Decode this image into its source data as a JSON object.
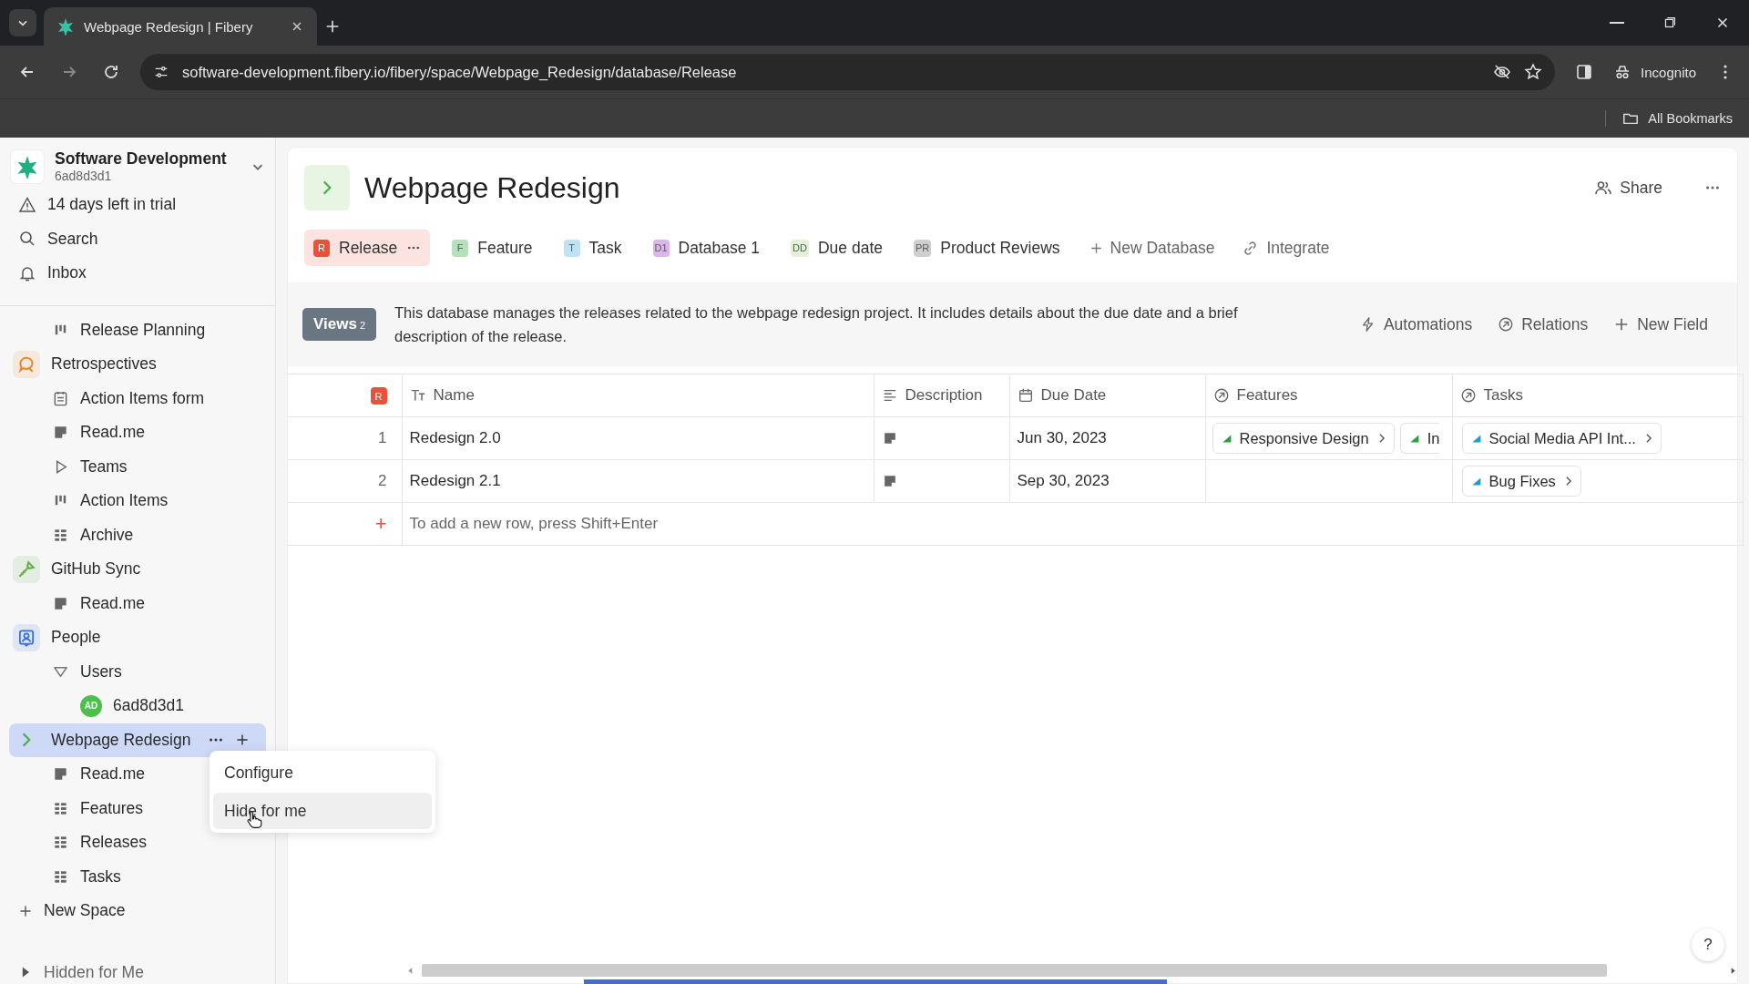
{
  "browser": {
    "tab_title": "Webpage Redesign | Fibery",
    "url": "software-development.fibery.io/fibery/space/Webpage_Redesign/database/Release",
    "profile": "Incognito",
    "bookmarks": "All Bookmarks"
  },
  "sidebar": {
    "workspace": {
      "name": "Software Development",
      "id": "6ad8d3d1"
    },
    "top_items": [
      {
        "kind": "warning",
        "label": "14 days left in trial"
      },
      {
        "kind": "search",
        "label": "Search"
      },
      {
        "kind": "bell",
        "label": "Inbox"
      }
    ],
    "orphan_items": [
      {
        "kind": "board",
        "label": "Release Planning"
      }
    ],
    "spaces": [
      {
        "kind": "retro",
        "label": "Retrospectives",
        "color": "#e8862a",
        "selected": false,
        "children": [
          {
            "kind": "form",
            "label": "Action Items form"
          },
          {
            "kind": "doc",
            "label": "Read.me"
          },
          {
            "kind": "view",
            "label": "Teams"
          },
          {
            "kind": "board",
            "label": "Action Items"
          },
          {
            "kind": "grid",
            "label": "Archive"
          }
        ]
      },
      {
        "kind": "sync",
        "label": "GitHub Sync",
        "color": "#6ab04c",
        "selected": false,
        "children": [
          {
            "kind": "doc",
            "label": "Read.me"
          }
        ]
      },
      {
        "kind": "people",
        "label": "People",
        "color": "#3b6fd8",
        "selected": false,
        "children": [
          {
            "kind": "folder",
            "label": "Users",
            "expanded": true,
            "children": [
              {
                "kind": "avatar",
                "label": "6ad8d3d1",
                "initials": "AD"
              }
            ]
          }
        ]
      },
      {
        "kind": "chevron",
        "label": "Webpage Redesign",
        "color": "#4caf50",
        "selected": true,
        "children": [
          {
            "kind": "doc",
            "label": "Read.me"
          },
          {
            "kind": "grid",
            "label": "Features"
          },
          {
            "kind": "grid",
            "label": "Releases"
          },
          {
            "kind": "grid",
            "label": "Tasks"
          }
        ]
      }
    ],
    "new_space": "New Space",
    "hidden_section": "Hidden for Me"
  },
  "context_menu": {
    "items": [
      {
        "label": "Configure",
        "selected": false
      },
      {
        "label": "Hide for me",
        "selected": true
      }
    ]
  },
  "page": {
    "title": "Webpage Redesign",
    "share": "Share",
    "tabs": [
      {
        "badge": "R",
        "label": "Release",
        "color": "#e5533d",
        "selected": true
      },
      {
        "badge": "F",
        "label": "Feature",
        "color": "#b5e0bc",
        "selected": false
      },
      {
        "badge": "T",
        "label": "Task",
        "color": "#bfe2f4",
        "selected": false
      },
      {
        "badge": "D1",
        "label": "Database 1",
        "color": "#dcb6ea",
        "selected": false
      },
      {
        "badge": "DD",
        "label": "Due date",
        "color": "#e3f1d6",
        "selected": false
      },
      {
        "badge": "PR",
        "label": "Product Reviews",
        "color": "#cfcfcf",
        "selected": false
      }
    ],
    "new_database": "New Database",
    "integrate": "Integrate",
    "views": {
      "label": "Views",
      "count": "2"
    },
    "description": "This database manages the releases related to the webpage redesign project. It includes details about the due date and a brief description of the release.",
    "actions": [
      {
        "kind": "bolt",
        "label": "Automations"
      },
      {
        "kind": "relations",
        "label": "Relations"
      },
      {
        "kind": "plus",
        "label": "New Field"
      }
    ],
    "table": {
      "badge": "R",
      "columns": [
        {
          "kind": "text",
          "label": "Name"
        },
        {
          "kind": "lines",
          "label": "Description"
        },
        {
          "kind": "calendar",
          "label": "Due Date"
        },
        {
          "kind": "relation",
          "label": "Features"
        },
        {
          "kind": "relation",
          "label": "Tasks"
        }
      ],
      "rows": [
        {
          "index": "1",
          "name": "Redesign 2.0",
          "has_description": true,
          "due": "Jun 30, 2023",
          "features": [
            {
              "label": "Responsive Design",
              "color": "#2e9e3a",
              "cut": false
            },
            {
              "label": "In",
              "color": "#2e9e3a",
              "cut": true
            }
          ],
          "tasks": [
            {
              "label": "Social Media API Int...",
              "color": "#1c9fc7",
              "cut": false
            }
          ]
        },
        {
          "index": "2",
          "name": "Redesign 2.1",
          "has_description": true,
          "due": "Sep 30, 2023",
          "features": [],
          "tasks": [
            {
              "label": "Bug Fixes",
              "color": "#1c9fc7",
              "cut": false
            }
          ]
        }
      ],
      "add_row": {
        "symbol": "+",
        "hint": "To add a new row, press Shift+Enter"
      }
    },
    "help": "?"
  }
}
